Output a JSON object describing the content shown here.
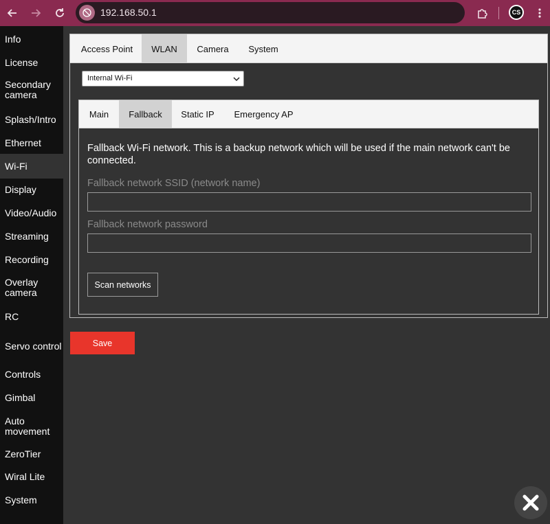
{
  "browser": {
    "url": "192.168.50.1",
    "profile_initials": "CS"
  },
  "sidebar": {
    "items": [
      {
        "label": "Info"
      },
      {
        "label": "License"
      },
      {
        "label": "Secondary camera"
      },
      {
        "label": "Splash/Intro"
      },
      {
        "label": "Ethernet"
      },
      {
        "label": "Wi-Fi"
      },
      {
        "label": "Display"
      },
      {
        "label": "Video/Audio"
      },
      {
        "label": "Streaming"
      },
      {
        "label": "Recording"
      },
      {
        "label": "Overlay camera"
      },
      {
        "label": "RC"
      },
      {
        "label": "Servo control"
      },
      {
        "label": "Controls"
      },
      {
        "label": "Gimbal"
      },
      {
        "label": "Auto movement"
      },
      {
        "label": "ZeroTier"
      },
      {
        "label": "Wiral Lite"
      },
      {
        "label": "System"
      }
    ],
    "active": "Wi-Fi"
  },
  "tabs": [
    {
      "label": "Access Point"
    },
    {
      "label": "WLAN"
    },
    {
      "label": "Camera"
    },
    {
      "label": "System"
    }
  ],
  "active_tab": "WLAN",
  "interface_select": {
    "value": "Internal Wi-Fi"
  },
  "sub_tabs": [
    {
      "label": "Main"
    },
    {
      "label": "Fallback"
    },
    {
      "label": "Static IP"
    },
    {
      "label": "Emergency AP"
    }
  ],
  "active_sub_tab": "Fallback",
  "fallback": {
    "description": "Fallback Wi-Fi network. This is a backup network which will be used if the main network can't be connected.",
    "ssid_label": "Fallback network SSID (network name)",
    "ssid_value": "",
    "password_label": "Fallback network password",
    "password_value": "",
    "scan_label": "Scan networks"
  },
  "save_label": "Save",
  "colors": {
    "browser_bar": "#8a2a50",
    "sidebar_bg": "#111111",
    "content_bg": "#333333",
    "save_button": "#e8352b"
  }
}
